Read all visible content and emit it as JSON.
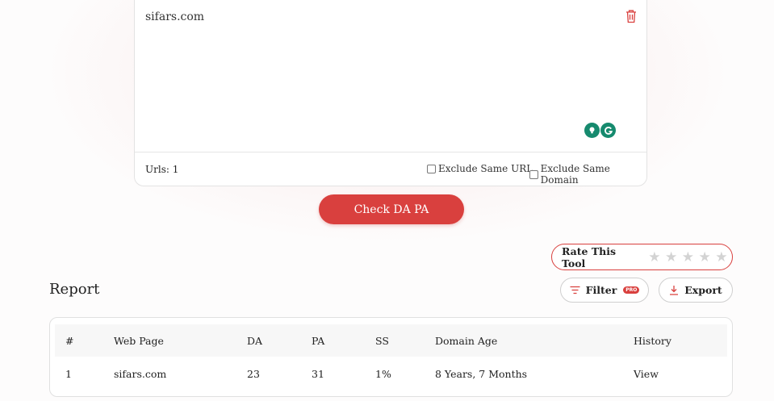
{
  "input": {
    "url_text": "sifars.com",
    "urls_label": "Urls: 1",
    "exclude_same_url": "Exclude Same URL",
    "exclude_same_domain": "Exclude Same Domain"
  },
  "check_button": "Check DA PA",
  "rate": {
    "label": "Rate This Tool",
    "stars": [
      "★",
      "★",
      "★",
      "★",
      "★"
    ],
    "rating": 0
  },
  "report": {
    "title": "Report",
    "filter_label": "Filter",
    "pro_badge": "PRO",
    "export_label": "Export",
    "columns": [
      "#",
      "Web Page",
      "DA",
      "PA",
      "SS",
      "Domain Age",
      "History"
    ],
    "rows": [
      [
        "1",
        "sifars.com",
        "23",
        "31",
        "1%",
        "8 Years, 7 Months",
        "View"
      ]
    ]
  },
  "colors": {
    "accent": "#d9403e",
    "extension": "#168a6e"
  },
  "icons": [
    "trash-icon",
    "bulb-icon",
    "grammarly-icon",
    "filter-icon",
    "download-icon",
    "star-icon"
  ]
}
